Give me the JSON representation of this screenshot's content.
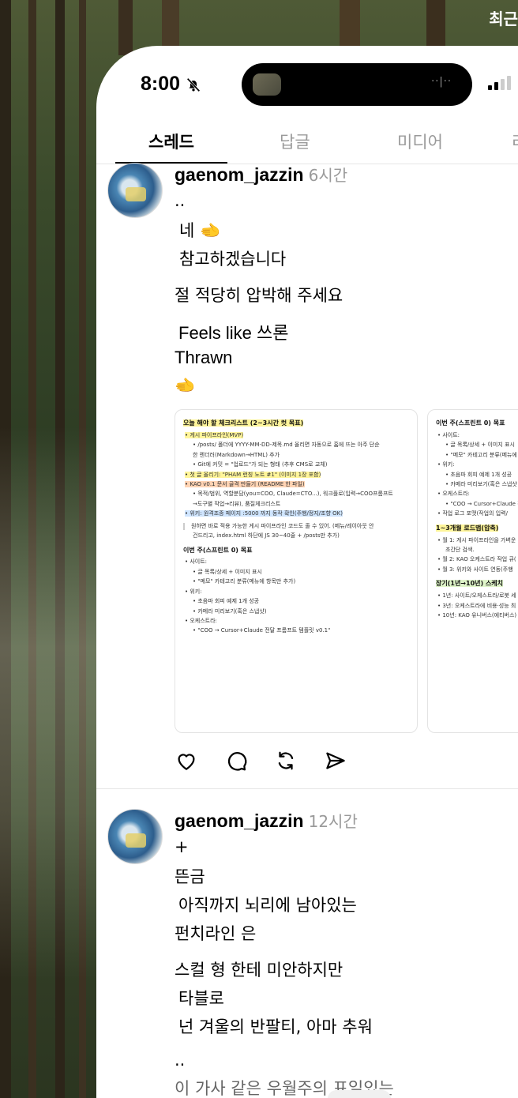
{
  "corner_label": "최근",
  "status_bar": {
    "time": "8:00"
  },
  "tabs": [
    "스레드",
    "답글",
    "미디어",
    "리"
  ],
  "posts": [
    {
      "username": "gaenom_jazzin",
      "time_ago": "6시간",
      "lines": [
        "..",
        "네 🫲",
        "참고하겠습니다",
        "절 적당히 압박해 주세요",
        "Feels like 쓰론",
        "Thrawn",
        "🫲"
      ],
      "image1": {
        "title": "오늘 해야 할 체크리스트 (2~3시간 컷 목표)",
        "items": [
          "• 게시 파이프라인(MVP)",
          "• /posts/ 폴더에 YYYY-MM-DD-제목.md 올리면 자동으로 홈에 뜨는 아주 단순",
          "한 렌더러(Markdown→HTML) 추가",
          "• Git에 커밋 = \"업로드\"가 되는 형태 (추후 CMS로 교체)",
          "• 첫 글 올리기: \"PHAM 런칭 노트 #1\" (이미지 1장 포함)",
          "• KAO v0.1 문서 골격 만들기 (README 한 파일)",
          "• 목적/범위, 역할분담(you=COO, Claude=CTO...), 워크플로(입력→COO프롬프트",
          "→도구별 작업→리뷰), 품질체크리스트",
          "• 위키: 원격조종 페이지 :5000 까지 동작 확인(주행/정지/조향 OK)",
          "원하면 바로 적용 가능한 게시 파이프라인 코드도 줄 수 있어. (메뉴/레이아웃 안",
          "건드리고, index.html 하단에 JS 30~40줄 + /posts만 추가)",
          "이번 주(스프린트 0) 목표",
          "• 사이트:",
          "• 글 목록/상세 + 이미지 표시",
          "• \"메모\" 카테고리 분류(메뉴에 항목만 추가)",
          "• 위키:",
          "• 초음파 회피 예제 1개 성공",
          "• 카메라 미리보기(혹은 스냅샷)",
          "• 오케스트라:",
          "• \"COO → Cursor+Claude 전달 프롬프트 템플릿 v0.1\""
        ]
      },
      "image2": {
        "title": "이번 주(스프린트 0) 목표",
        "items": [
          "• 사이트:",
          "• 글 목록/상세 + 이미지 표시",
          "• \"메모\" 카테고리 분류(메뉴에",
          "• 위키:",
          "• 초음파 회피 예제 1개 성공",
          "• 카메라 미리보기(혹은 스냅샷",
          "• 오케스트라:",
          "• \"COO → Cursor+Claude 전",
          "• 작업 로그 포맷(작업의 입력/",
          "1~3개월 로드맵(압축)",
          "• 월 1: 게시 파이프라인을 가벼운",
          "초간단 검색.",
          "• 월 2: KAO 오케스트라 작업 큐(",
          "• 월 3: 위키와 사이트 연동(주행",
          "장기(1년→10년) 스케치",
          "• 1년: 사이트/오케스트라/로봇 세",
          "• 3년: 오케스트라에 비용·성능 최",
          "• 10년: KAO 유니버스(에티버스)"
        ]
      }
    },
    {
      "username": "gaenom_jazzin",
      "time_ago": "12시간",
      "lines": [
        "+",
        "뜬금",
        "아직까지 뇌리에 남아있는",
        "펀치라인 은",
        "스컬 형 한테 미안하지만",
        "타블로",
        "넌 겨울의 반팔티, 아마 추워",
        "..",
        "이 가사 같은 우월주의 표일있는"
      ]
    }
  ]
}
